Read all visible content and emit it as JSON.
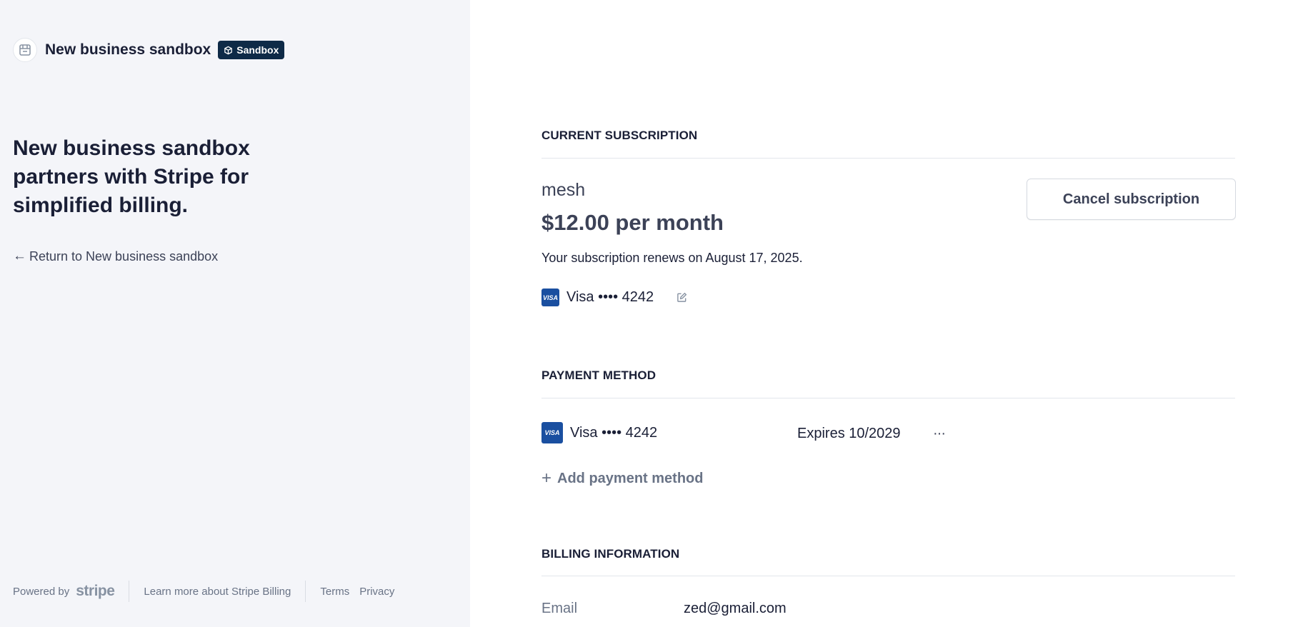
{
  "business": {
    "name": "New business sandbox",
    "badge": "Sandbox"
  },
  "tagline": "New business sandbox partners with Stripe for simplified billing.",
  "return_link": "Return to New business sandbox",
  "footer": {
    "powered_by": "Powered by",
    "brand": "stripe",
    "learn_more": "Learn more about Stripe Billing",
    "terms": "Terms",
    "privacy": "Privacy"
  },
  "subscription": {
    "section_title": "CURRENT SUBSCRIPTION",
    "plan_name": "mesh",
    "price": "$12.00 per month",
    "renewal": "Your subscription renews on August 17, 2025.",
    "card_brand_mark": "VISA",
    "card_label": "Visa •••• 4242",
    "cancel_label": "Cancel subscription"
  },
  "payment_method": {
    "section_title": "PAYMENT METHOD",
    "card_brand_mark": "VISA",
    "card_label": "Visa •••• 4242",
    "expires": "Expires 10/2029",
    "more": "···",
    "add_label": "Add payment method"
  },
  "billing": {
    "section_title": "BILLING INFORMATION",
    "email_label": "Email",
    "email_value": "zed@gmail.com"
  },
  "colors": {
    "left_panel_bg": "#f4f5f9",
    "badge_bg": "#0e2a47",
    "visa_blue": "#1a4fa0",
    "text_dark": "#1a1f36",
    "text_muted": "#697386"
  },
  "icons": {
    "brand_logo": "storefront-icon",
    "badge": "sandbox-cube-icon",
    "return": "arrow-left-icon",
    "edit": "edit-icon",
    "more": "more-horizontal-icon",
    "add": "plus-icon"
  }
}
